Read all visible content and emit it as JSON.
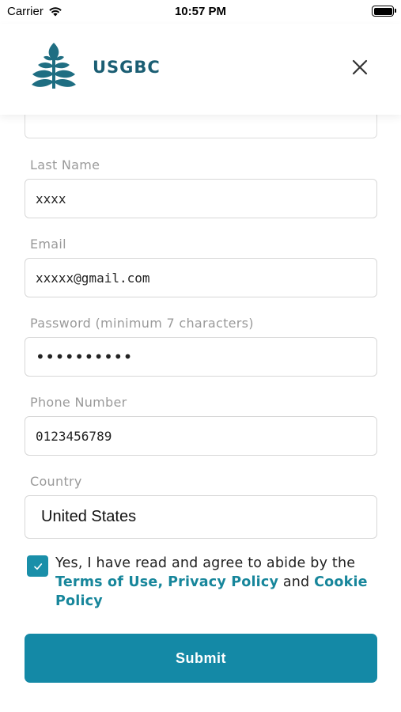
{
  "status_bar": {
    "carrier": "Carrier",
    "time": "10:57 PM"
  },
  "header": {
    "brand": "USGBC",
    "logo_icon": "usgbc-leaf-logo-icon",
    "close_icon": "close-icon",
    "brand_color": "#1b5e73"
  },
  "form": {
    "last_name": {
      "label": "Last Name",
      "value": "xxxx"
    },
    "email": {
      "label": "Email",
      "value": "xxxxx@gmail.com"
    },
    "password": {
      "label": "Password (minimum 7 characters)",
      "value": "••••••••••"
    },
    "phone": {
      "label": "Phone Number",
      "value": "0123456789"
    },
    "country": {
      "label": "Country",
      "value": "United States"
    },
    "agreement": {
      "checked": true,
      "text_before": "Yes, I have read and agree to abide by the ",
      "terms_link": "Terms of Use,",
      "privacy_link": "Privacy Policy",
      "and_text": " and ",
      "cookie_link": "Cookie Policy"
    },
    "submit_label": "Submit"
  },
  "colors": {
    "accent": "#1489a6",
    "link": "#17869b",
    "label": "#9a9a9a"
  }
}
